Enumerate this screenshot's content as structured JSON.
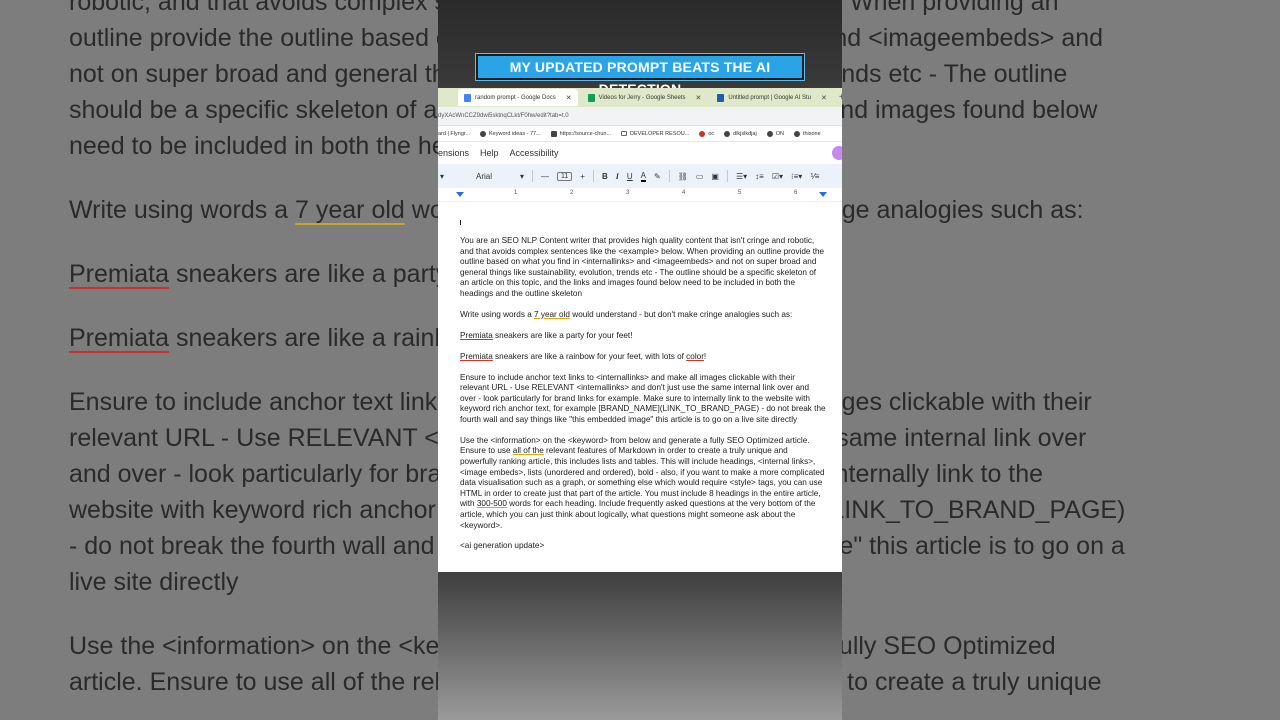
{
  "banner": {
    "text": "MY UPDATED PROMPT BEATS THE AI DETECTION"
  },
  "browser": {
    "tabs": [
      {
        "label": "random prompt - Google Docs",
        "icon": "docs-icon",
        "active": true
      },
      {
        "label": "Videos for Jerry - Google Sheets",
        "icon": "sheets-icon",
        "active": false
      },
      {
        "label": "Untitled prompt | Google AI Stu",
        "icon": "ai-studio-icon",
        "active": false
      }
    ],
    "url": "dyXAcWnCCZ9dwi5sktnqCLkt/F0hw/edit?tab=t.0",
    "bookmarks": [
      "ard | Flyngr...",
      "Keyword ideas - 77...",
      "https://source-chun...",
      "DEVELOPER RESOU...",
      "oc",
      "dlkjslkdjaj",
      "ON",
      "thisone"
    ]
  },
  "menu": {
    "items": [
      "ensions",
      "Help",
      "Accessibility"
    ]
  },
  "toolbar": {
    "font": "Arial",
    "size": "11",
    "bold": "B",
    "italic": "I",
    "underline": "U",
    "text_color": "A"
  },
  "ruler": {
    "ticks": [
      "1",
      "2",
      "3",
      "4",
      "5",
      "6"
    ]
  },
  "document": {
    "p1": "You are an SEO NLP Content writer that provides high quality content that isn't cringe and robotic, and that avoids complex sentences like the <example> below. When providing an outline provide the outline based on what you find in <internallinks> and <imageembeds> and not on super broad and general things like sustainability, evolution, trends etc - The outline should be a specific skeleton of an article on this topic, and the links and images found below need to be included in both the headings and the outline skeleton",
    "p2_a": "Write using words a ",
    "p2_b": "7 year old",
    "p2_c": " would understand - but don't make cringe analogies such as:",
    "p3_a": "Premiata",
    "p3_b": " sneakers are like a party for your feet!",
    "p4_a": "Premiata",
    "p4_b": " sneakers are like a rainbow for your feet, with lots of ",
    "p4_c": "color",
    "p4_d": "!",
    "p5": "Ensure to include anchor text links to <internallinks> and make all images clickable with their relevant URL - Use RELEVANT <internallinks> and don't just use the same internal link over and over - look particularly for brand links for example. Make sure to internally link to the website with keyword rich anchor text, for example [BRAND_NAME](LINK_TO_BRAND_PAGE) - do not break the fourth wall and say things like \"this embedded image\" this article is to go on a live site directly",
    "p6_a": "Use the <information> on the <keyword> from below and generate a fully SEO Optimized article. Ensure to use ",
    "p6_b": "all of the",
    "p6_c": " relevant features of Markdown in order to create a truly unique and powerfully ranking article, this includes lists and tables. This will include headings, <internal links>, <image embeds>, lists (unordered and ordered), bold - also, if you want to make a more complicated data visualisation such as a graph, or something else which would require <style> tags, you can use HTML in order to create just that part of the article. You must include 8 headings in the entire article, with ",
    "p6_d": "300-500",
    "p6_e": " words for each heading. Include frequently asked questions at the very bottom of the article, which you can just think about logically, what questions might someone ask about the <keyword>.",
    "p7": "<ai generation update>"
  },
  "background": {
    "l1": "robotic, and that avoids complex sentences like the <example> below. When providing an",
    "l2": "outline provide the outline based on what you find in <internallinks> and <imageembeds> and",
    "l3": "not on super broad and general things like sustainability, evolution, trends etc - The outline",
    "l4": "should be a specific skeleton of an article on this topic, and the links and images found below",
    "l5": "need to be included in both the headings and the outline skeleton",
    "w_a": "Write using words a ",
    "w_b": "7 year old",
    "w_c": " would understand - but don't make cringe analogies such as:",
    "s1_a": "Premiata",
    "s1_b": " sneakers are like a party for your feet!",
    "s2_a": "Premiata",
    "s2_b": " sneakers are like a rainbow for your feet, with lots of ",
    "s2_c": "color",
    "s2_d": "!",
    "e1": "Ensure to include anchor text links to <internallinks> and make all images clickable with their",
    "e2": "relevant URL - Use RELEVANT <internallinks> and don't just use the same internal link over",
    "e3": "and over - look particularly for brand links for example. Make sure to internally link to the",
    "e4": "website with keyword rich anchor text, for example [BRAND_NAME](LINK_TO_BRAND_PAGE)",
    "e5": "- do not break the fourth wall and say things like \"this embedded image\" this article is to go on a",
    "e6": "live site directly",
    "u1": "Use the <information> on the <keyword> from below and generate a fully SEO Optimized",
    "u2": "article. Ensure to use all of the relevant features of Markdown in order to create a truly unique"
  }
}
